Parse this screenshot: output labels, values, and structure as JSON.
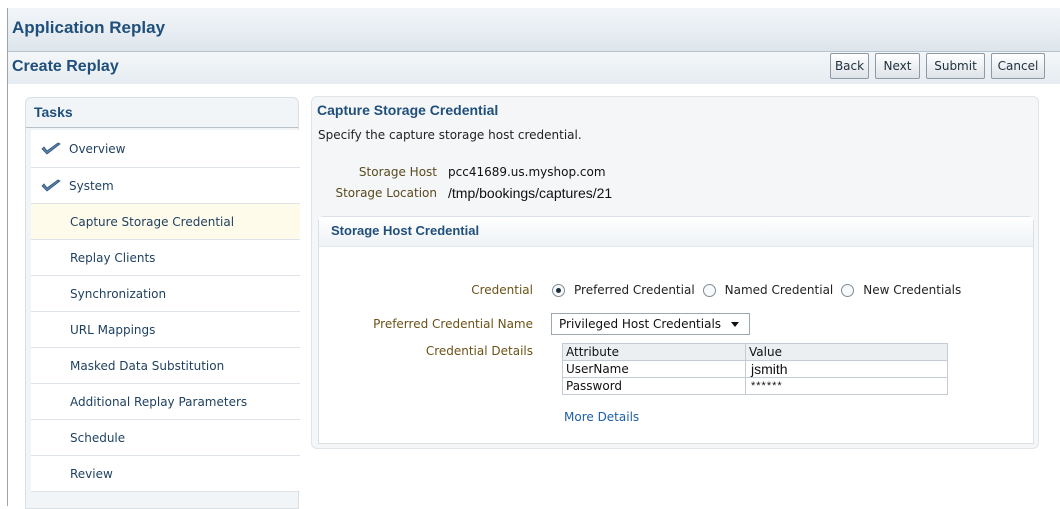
{
  "app": {
    "title": "Application Replay"
  },
  "page": {
    "title": "Create Replay"
  },
  "buttons": {
    "back": "Back",
    "next": "Next",
    "submit": "Submit",
    "cancel": "Cancel"
  },
  "tasks": {
    "header": "Tasks",
    "items": [
      {
        "label": "Overview",
        "completed": true
      },
      {
        "label": "System",
        "completed": true
      },
      {
        "label": "Capture Storage Credential",
        "current": true
      },
      {
        "label": "Replay Clients"
      },
      {
        "label": "Synchronization"
      },
      {
        "label": "URL Mappings"
      },
      {
        "label": "Masked Data Substitution"
      },
      {
        "label": "Additional Replay Parameters"
      },
      {
        "label": "Schedule"
      },
      {
        "label": "Review"
      }
    ]
  },
  "section": {
    "title": "Capture Storage Credential",
    "description": "Specify the capture storage host credential.",
    "storage_host_label": "Storage Host",
    "storage_host_value": "pcc41689.us.myshop.com",
    "storage_location_label": "Storage Location",
    "storage_location_value": "/tmp/bookings/captures/21"
  },
  "credential_panel": {
    "title": "Storage Host Credential",
    "credential_label": "Credential",
    "options": [
      "Preferred Credential",
      "Named Credential",
      "New Credentials"
    ],
    "selected_option": "Preferred Credential",
    "preferred_name_label": "Preferred Credential Name",
    "preferred_name_value": "Privileged Host Credentials",
    "details_label": "Credential Details",
    "table": {
      "headers": [
        "Attribute",
        "Value"
      ],
      "rows": [
        [
          "UserName",
          "jsmith"
        ],
        [
          "Password",
          "******"
        ]
      ]
    },
    "more_details_link": "More Details"
  },
  "colors": {
    "heading": "#1f4f7a",
    "link": "#1e5fa5",
    "label": "#6b5217",
    "current_task_bg": "#fffbea"
  }
}
